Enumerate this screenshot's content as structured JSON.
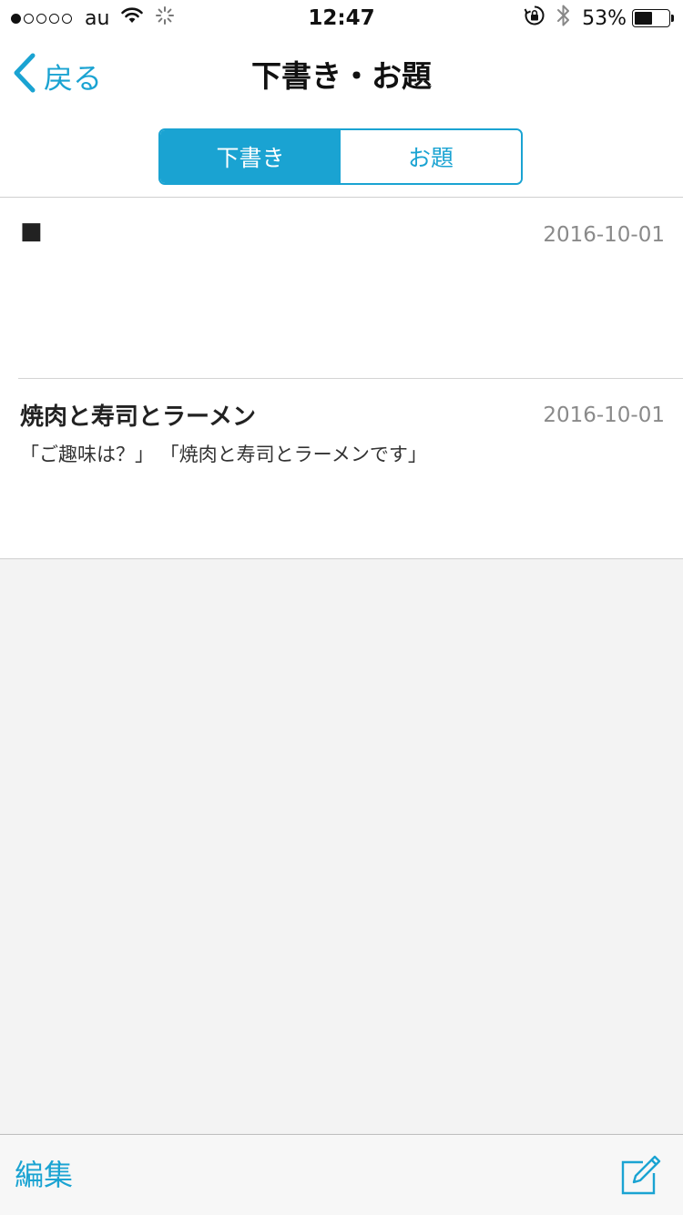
{
  "status_bar": {
    "carrier": "au",
    "time": "12:47",
    "battery_percent": "53%",
    "battery_level": 0.53,
    "signal_strength": 1,
    "signal_total": 5
  },
  "nav": {
    "back_label": "戻る",
    "title": "下書き・お題"
  },
  "segments": [
    {
      "label": "下書き",
      "selected": true
    },
    {
      "label": "お題",
      "selected": false
    }
  ],
  "drafts": [
    {
      "title": "■",
      "date": "2016-10-01",
      "preview": ""
    },
    {
      "title": "焼肉と寿司とラーメン",
      "date": "2016-10-01",
      "preview": "「ご趣味は？」 「焼肉と寿司とラーメンです」"
    }
  ],
  "toolbar": {
    "edit_label": "編集"
  },
  "colors": {
    "accent": "#1aa3d2",
    "background": "#f3f3f3",
    "date_text": "#8a8a8a"
  }
}
